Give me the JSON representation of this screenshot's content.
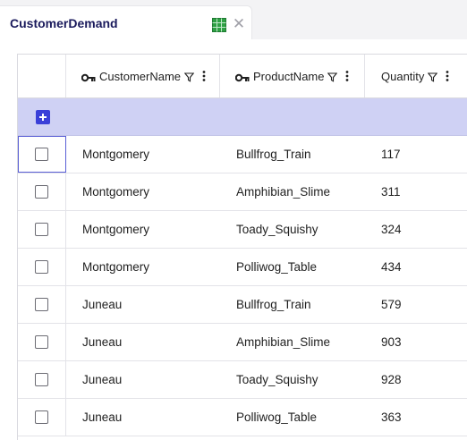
{
  "tab": {
    "title": "CustomerDemand",
    "table_icon": "table-grid-icon",
    "close_icon": "close-icon",
    "table_icon_color": "#2ea043"
  },
  "columns": [
    {
      "label": "CustomerName",
      "key": true
    },
    {
      "label": "ProductName",
      "key": true
    },
    {
      "label": "Quantity",
      "key": false
    }
  ],
  "add_row": {
    "icon": "add-icon",
    "color": "#3a3fd8"
  },
  "rows": [
    {
      "customer": "Montgomery",
      "product": "Bullfrog_Train",
      "quantity": "117"
    },
    {
      "customer": "Montgomery",
      "product": "Amphibian_Slime",
      "quantity": "311"
    },
    {
      "customer": "Montgomery",
      "product": "Toady_Squishy",
      "quantity": "324"
    },
    {
      "customer": "Montgomery",
      "product": "Polliwog_Table",
      "quantity": "434"
    },
    {
      "customer": "Juneau",
      "product": "Bullfrog_Train",
      "quantity": "579"
    },
    {
      "customer": "Juneau",
      "product": "Amphibian_Slime",
      "quantity": "903"
    },
    {
      "customer": "Juneau",
      "product": "Toady_Squishy",
      "quantity": "928"
    },
    {
      "customer": "Juneau",
      "product": "Polliwog_Table",
      "quantity": "363"
    }
  ]
}
